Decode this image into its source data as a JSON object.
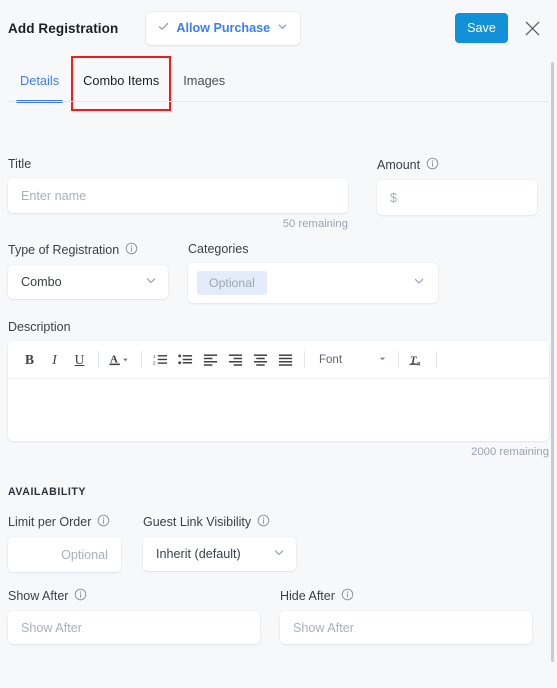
{
  "header": {
    "title": "Add Registration",
    "allow_purchase_label": "Allow Purchase",
    "check_icon": "check-icon",
    "chevron_icon": "chevron-down-icon",
    "save_label": "Save",
    "close_icon": "close-icon",
    "save_color": "#1290d8",
    "accent_color": "#3d7df6"
  },
  "tabs": {
    "items": [
      {
        "label": "Details",
        "active": true
      },
      {
        "label": "Combo Items",
        "active": false,
        "highlighted": true
      },
      {
        "label": "Images",
        "active": false
      }
    ],
    "highlight_color": "#f01b1b"
  },
  "form": {
    "title": {
      "label": "Title",
      "placeholder": "Enter name",
      "value": "",
      "helper": "50 remaining"
    },
    "amount": {
      "label": "Amount",
      "placeholder": "$",
      "value": "",
      "info_icon": "info-icon"
    },
    "type_of_registration": {
      "label": "Type of Registration",
      "value": "Combo",
      "info_icon": "info-icon",
      "chevron_icon": "chevron-down-icon"
    },
    "categories": {
      "label": "Categories",
      "chip": "Optional",
      "chip_bg": "#e4ecfb",
      "chevron_icon": "chevron-down-icon"
    },
    "description": {
      "label": "Description",
      "helper": "2000 remaining",
      "value": "",
      "toolbar": [
        {
          "name": "bold-icon",
          "glyph": "B"
        },
        {
          "name": "italic-icon",
          "glyph": "I"
        },
        {
          "name": "underline-icon",
          "glyph": "U"
        },
        {
          "name": "text-color-icon",
          "glyph": "A"
        },
        {
          "name": "ordered-list-icon",
          "glyph": ""
        },
        {
          "name": "unordered-list-icon",
          "glyph": ""
        },
        {
          "name": "align-left-icon",
          "glyph": ""
        },
        {
          "name": "align-right-icon",
          "glyph": ""
        },
        {
          "name": "align-center-icon",
          "glyph": ""
        },
        {
          "name": "align-justify-icon",
          "glyph": ""
        },
        {
          "name": "clear-format-icon",
          "glyph": ""
        }
      ],
      "font_label": "Font"
    }
  },
  "availability": {
    "heading": "AVAILABILITY",
    "limit_per_order": {
      "label": "Limit per Order",
      "placeholder": "Optional",
      "value": "",
      "info_icon": "info-icon"
    },
    "guest_link_visibility": {
      "label": "Guest Link Visibility",
      "value": "Inherit (default)",
      "info_icon": "info-icon",
      "chevron_icon": "chevron-down-icon"
    },
    "show_after": {
      "label": "Show After",
      "placeholder": "Show After",
      "value": "",
      "info_icon": "info-icon"
    },
    "hide_after": {
      "label": "Hide After",
      "placeholder": "Show After",
      "value": "",
      "info_icon": "info-icon"
    }
  }
}
